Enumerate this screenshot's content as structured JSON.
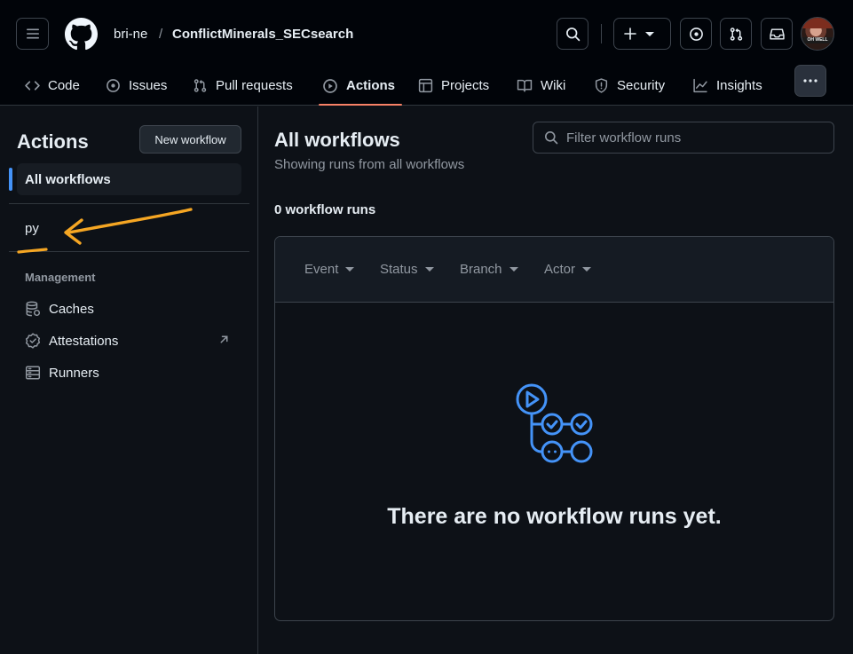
{
  "header": {
    "owner": "bri-ne",
    "separator": "/",
    "repo": "ConflictMinerals_SECsearch",
    "avatar_text": "OH WELL",
    "icons": [
      "menu-icon",
      "github-logo-icon",
      "search-icon",
      "plus-icon",
      "chevron-down-icon",
      "issue-opened-icon",
      "git-pull-request-icon",
      "inbox-icon"
    ]
  },
  "tabs": [
    {
      "label": "Code",
      "icon": "code-icon"
    },
    {
      "label": "Issues",
      "icon": "issue-opened-icon"
    },
    {
      "label": "Pull requests",
      "icon": "git-pull-request-icon"
    },
    {
      "label": "Actions",
      "icon": "play-icon",
      "active": true
    },
    {
      "label": "Projects",
      "icon": "table-icon"
    },
    {
      "label": "Wiki",
      "icon": "book-icon"
    },
    {
      "label": "Security",
      "icon": "shield-icon"
    },
    {
      "label": "Insights",
      "icon": "graph-icon"
    }
  ],
  "sidebar": {
    "title": "Actions",
    "new_workflow": "New workflow",
    "all_workflows": "All workflows",
    "workflows": [
      "py"
    ],
    "management_label": "Management",
    "management_items": [
      {
        "label": "Caches",
        "icon": "database-icon"
      },
      {
        "label": "Attestations",
        "icon": "verified-icon"
      },
      {
        "label": "Runners",
        "icon": "server-icon"
      }
    ]
  },
  "main": {
    "title": "All workflows",
    "subtitle": "Showing runs from all workflows",
    "filter_placeholder": "Filter workflow runs",
    "run_count": "0 workflow runs",
    "filters": [
      "Event",
      "Status",
      "Branch",
      "Actor"
    ],
    "empty_message": "There are no workflow runs yet."
  },
  "colors": {
    "accent": "#4493f8",
    "tab_underline": "#f78166",
    "annotation": "#f5a623"
  }
}
